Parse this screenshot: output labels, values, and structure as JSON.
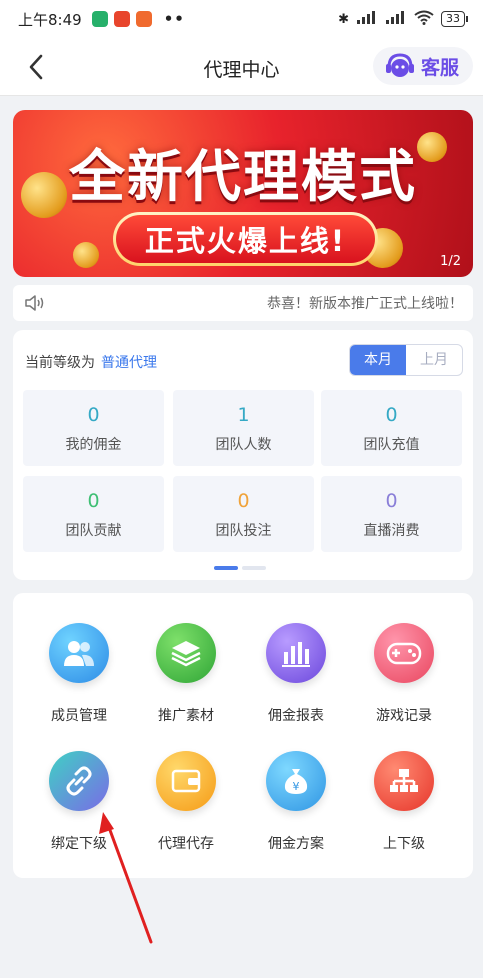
{
  "status_bar": {
    "time": "上午8:49",
    "dots": "••",
    "battery": "33"
  },
  "navbar": {
    "title": "代理中心",
    "service_label": "客服"
  },
  "banner": {
    "title": "全新代理模式",
    "subtitle": "正式火爆上线!",
    "indicator": "1/2"
  },
  "notice": {
    "text": "恭喜！新版本推广正式上线啦！"
  },
  "level": {
    "prefix": "当前等级为",
    "value": "普通代理"
  },
  "period_toggle": {
    "current": "本月",
    "previous": "上月",
    "selected": "本月"
  },
  "stats": [
    {
      "value": "0",
      "label": "我的佣金"
    },
    {
      "value": "1",
      "label": "团队人数"
    },
    {
      "value": "0",
      "label": "团队充值"
    },
    {
      "value": "0",
      "label": "团队贡献"
    },
    {
      "value": "0",
      "label": "团队投注"
    },
    {
      "value": "0",
      "label": "直播消费"
    }
  ],
  "menu": [
    {
      "label": "成员管理",
      "icon": "members-icon",
      "color": "#3a8ee8"
    },
    {
      "label": "推广素材",
      "icon": "layers-icon",
      "color": "#3fae3f"
    },
    {
      "label": "佣金报表",
      "icon": "bar-chart-icon",
      "color": "#7c5be0"
    },
    {
      "label": "游戏记录",
      "icon": "gamepad-icon",
      "color": "#ef4f6b"
    },
    {
      "label": "绑定下级",
      "icon": "link-icon",
      "color": "#5fa0d8"
    },
    {
      "label": "代理代存",
      "icon": "wallet-icon",
      "color": "#f5a623"
    },
    {
      "label": "佣金方案",
      "icon": "money-bag-icon",
      "color": "#3aa1e6"
    },
    {
      "label": "上下级",
      "icon": "hierarchy-icon",
      "color": "#e8402f"
    }
  ],
  "colors": {
    "accent": "#4a7bea",
    "link": "#3b78ec",
    "annotation_arrow": "#e02020"
  }
}
